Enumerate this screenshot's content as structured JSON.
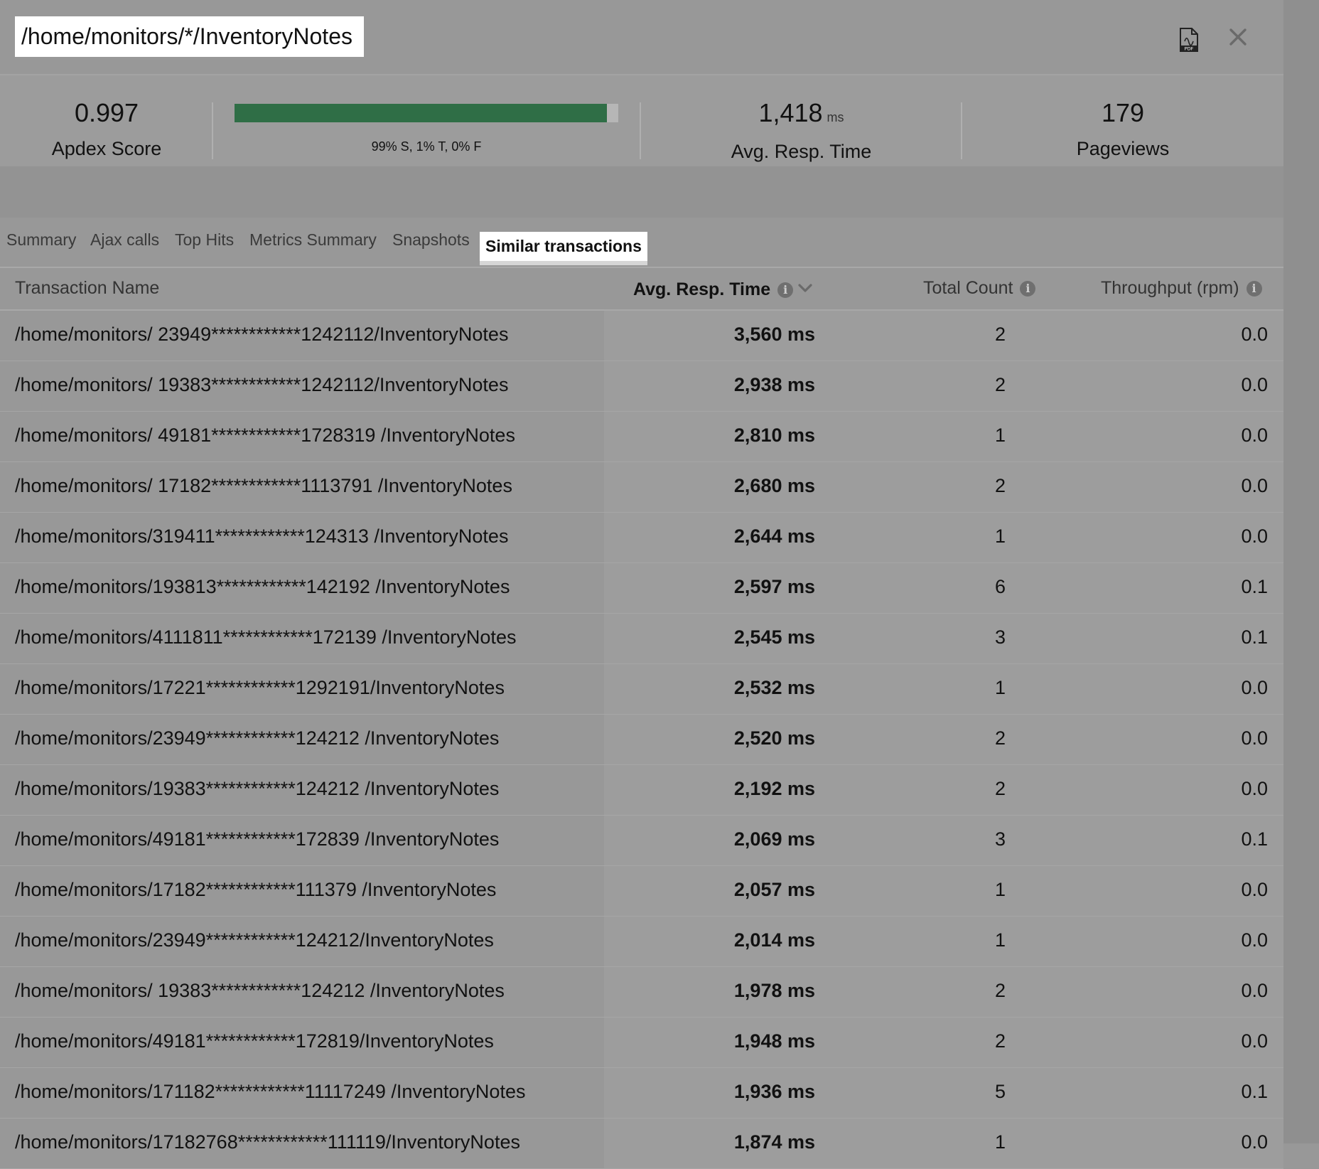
{
  "header": {
    "title": "/home/monitors/*/InventoryNotes",
    "pdf_icon_text": "PDF"
  },
  "stats": {
    "apdex": {
      "value": "0.997",
      "label": "Apdex Score"
    },
    "breakdown": {
      "satisfied_fraction": 0.97,
      "caption": "99% S, 1% T, 0% F"
    },
    "resp_time": {
      "value": "1,418",
      "unit": "ms",
      "label": "Avg. Resp. Time"
    },
    "pageviews": {
      "value": "179",
      "label": "Pageviews"
    }
  },
  "tabs": [
    {
      "label": "Summary",
      "active": false
    },
    {
      "label": "Ajax calls",
      "active": false
    },
    {
      "label": "Top Hits",
      "active": false
    },
    {
      "label": "Metrics Summary",
      "active": false
    },
    {
      "label": "Snapshots",
      "active": false
    },
    {
      "label": "Similar transactions",
      "active": true
    }
  ],
  "table": {
    "columns": {
      "name": "Transaction Name",
      "resp_time": "Avg. Resp. Time",
      "count": "Total Count",
      "throughput": "Throughput (rpm)"
    },
    "info_glyph": "i",
    "rows": [
      {
        "name": "/home/monitors/ 23949************1242112/InventoryNotes",
        "resp_time": "3,560 ms",
        "count": "2",
        "throughput": "0.0"
      },
      {
        "name": "/home/monitors/ 19383************1242112/InventoryNotes",
        "resp_time": "2,938 ms",
        "count": "2",
        "throughput": "0.0"
      },
      {
        "name": "/home/monitors/ 49181************1728319 /InventoryNotes",
        "resp_time": "2,810 ms",
        "count": "1",
        "throughput": "0.0"
      },
      {
        "name": "/home/monitors/ 17182************1113791 /InventoryNotes",
        "resp_time": "2,680 ms",
        "count": "2",
        "throughput": "0.0"
      },
      {
        "name": "/home/monitors/319411************124313 /InventoryNotes",
        "resp_time": "2,644 ms",
        "count": "1",
        "throughput": "0.0"
      },
      {
        "name": "/home/monitors/193813************142192 /InventoryNotes",
        "resp_time": "2,597 ms",
        "count": "6",
        "throughput": "0.1"
      },
      {
        "name": "/home/monitors/4111811************172139 /InventoryNotes",
        "resp_time": "2,545 ms",
        "count": "3",
        "throughput": "0.1"
      },
      {
        "name": "/home/monitors/17221************1292191/InventoryNotes",
        "resp_time": "2,532 ms",
        "count": "1",
        "throughput": "0.0"
      },
      {
        "name": "/home/monitors/23949************124212 /InventoryNotes",
        "resp_time": "2,520 ms",
        "count": "2",
        "throughput": "0.0"
      },
      {
        "name": "/home/monitors/19383************124212    /InventoryNotes",
        "resp_time": "2,192 ms",
        "count": "2",
        "throughput": "0.0"
      },
      {
        "name": "/home/monitors/49181************172839 /InventoryNotes",
        "resp_time": "2,069 ms",
        "count": "3",
        "throughput": "0.1"
      },
      {
        "name": "/home/monitors/17182************111379    /InventoryNotes",
        "resp_time": "2,057 ms",
        "count": "1",
        "throughput": "0.0"
      },
      {
        "name": "/home/monitors/23949************124212/InventoryNotes",
        "resp_time": "2,014 ms",
        "count": "1",
        "throughput": "0.0"
      },
      {
        "name": "/home/monitors/ 19383************124212    /InventoryNotes",
        "resp_time": "1,978 ms",
        "count": "2",
        "throughput": "0.0"
      },
      {
        "name": "/home/monitors/49181************172819/InventoryNotes",
        "resp_time": "1,948 ms",
        "count": "2",
        "throughput": "0.0"
      },
      {
        "name": "/home/monitors/171182************11117249 /InventoryNotes",
        "resp_time": "1,936 ms",
        "count": "5",
        "throughput": "0.1"
      },
      {
        "name": "/home/monitors/17182768************111119/InventoryNotes",
        "resp_time": "1,874 ms",
        "count": "1",
        "throughput": "0.0"
      }
    ]
  },
  "colors": {
    "background": "#989898",
    "apdex_bar": "#2f6e46",
    "bar_track": "#b6b6b6"
  }
}
